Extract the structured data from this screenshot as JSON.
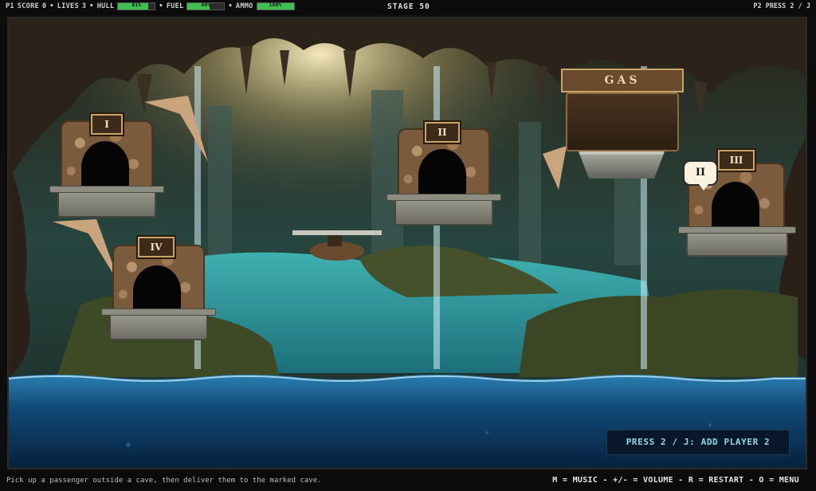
{
  "hud": {
    "player": "P1",
    "score_label": "SCORE",
    "score": "0",
    "lives_label": "LIVES",
    "lives": "3",
    "hull_label": "HULL",
    "hull_pct": "81%",
    "hull_value": 0.81,
    "fuel_label": "FUEL",
    "fuel_pct": "60%",
    "fuel_value": 0.6,
    "ammo_label": "AMMO",
    "ammo_pct": "100%",
    "ammo_value": 1.0,
    "sep": "•",
    "stage": "STAGE 50",
    "p2_prompt": "P2 PRESS 2 / J"
  },
  "caves": {
    "cave_1": "I",
    "cave_2": "II",
    "cave_3": "III",
    "cave_4": "IV"
  },
  "passenger_bubble": "II",
  "gas_station": {
    "label": "GAS"
  },
  "hint_box": "PRESS 2 / J: ADD PLAYER 2",
  "footer": {
    "instructions": "Pick up a passenger outside a cave, then deliver them to the marked cave.",
    "controls": "M = MUSIC - +/- = VOLUME - R = RESTART - O = MENU"
  },
  "colors": {
    "bar_fill": "#3fbf4f",
    "water": "#1a6fa6",
    "hint_text": "#8fd9ec"
  }
}
